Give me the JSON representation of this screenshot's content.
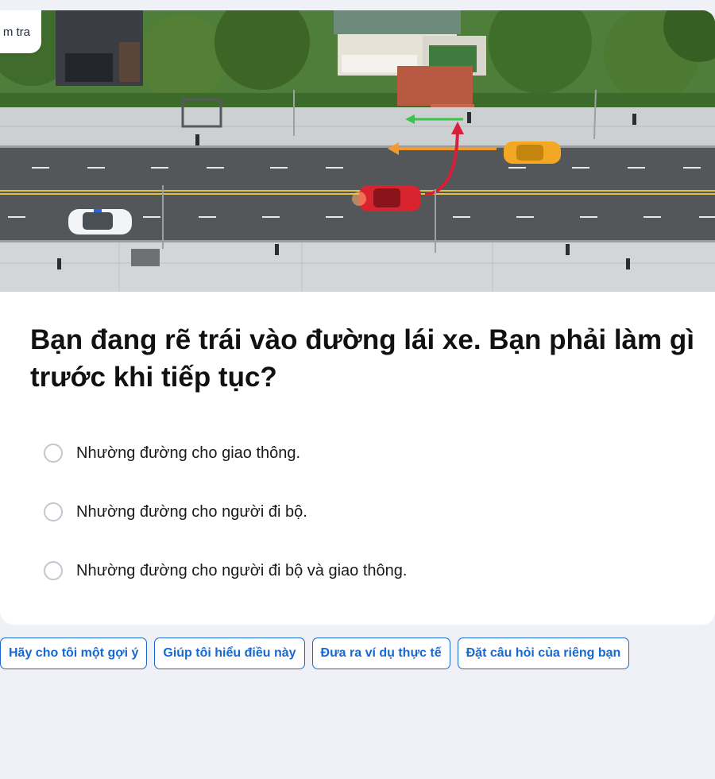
{
  "card": {
    "tag_label": "m tra",
    "question": "Bạn đang rẽ trái vào đường lái xe. Bạn phải làm gì trước khi tiếp tục?",
    "options": [
      {
        "label": "Nhường đường cho giao thông."
      },
      {
        "label": "Nhường đường cho người đi bộ."
      },
      {
        "label": "Nhường đường cho người đi bộ và giao thông."
      }
    ]
  },
  "help_chips": [
    {
      "label": "Hãy cho tôi một gợi ý"
    },
    {
      "label": "Giúp tôi hiểu điều này"
    },
    {
      "label": "Đưa ra ví dụ thực tế"
    },
    {
      "label": "Đặt câu hỏi của riêng bạn"
    }
  ],
  "colors": {
    "accent": "#1769d2",
    "page_background": "#eff1f6",
    "red_car": "#d8242f",
    "taxi": "#f2a823",
    "turn_arrow": "#d91e3c",
    "walk_arrow": "#39c44a",
    "lane_arrow": "#f39a2e"
  },
  "icons": [
    "radio-empty-icon"
  ]
}
